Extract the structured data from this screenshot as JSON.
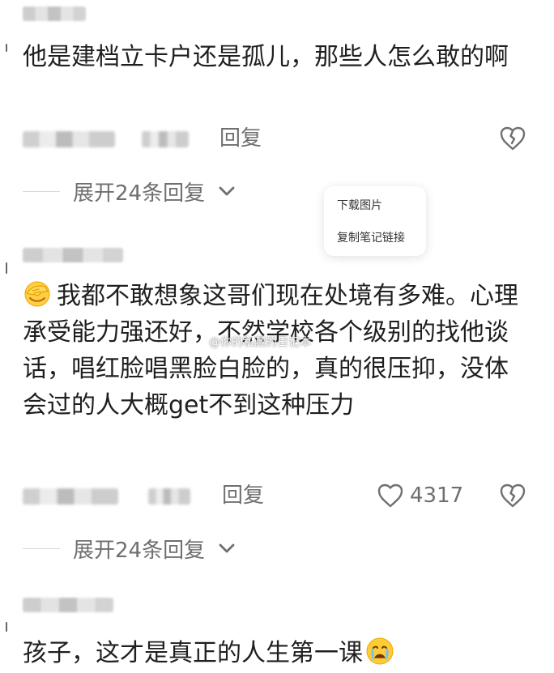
{
  "comments": [
    {
      "text": "他是建档立卡户还是孤儿，那些人怎么敢的啊",
      "reply_label": "回复",
      "expand_label": "展开24条回复"
    },
    {
      "text": "我都不敢想象这哥们现在处境有多难。心理承受能力强还好，不然学校各个级别的找他谈话，唱红脸唱黑脸白脸的，真的很压抑，没体会过的人大概get不到这种压力",
      "reply_label": "回复",
      "like_count": "4317",
      "expand_label": "展开24条回复"
    },
    {
      "text": "孩子，这才是真正的人生第一课"
    }
  ],
  "context_menu": {
    "items": [
      {
        "label": "下载图片"
      },
      {
        "label": "复制笔记链接"
      }
    ]
  },
  "watermark": "@你的私藏的日记本",
  "icons": {
    "chevron": "chevron-down-icon",
    "like": "heart-icon",
    "dislike": "broken-heart-icon",
    "emoji_facepalm": "facepalm-emoji",
    "emoji_crying": "crying-emoji"
  },
  "colors": {
    "text": "#1f1f1f",
    "meta": "#6f6f6f",
    "divider": "#d8d8d8"
  }
}
